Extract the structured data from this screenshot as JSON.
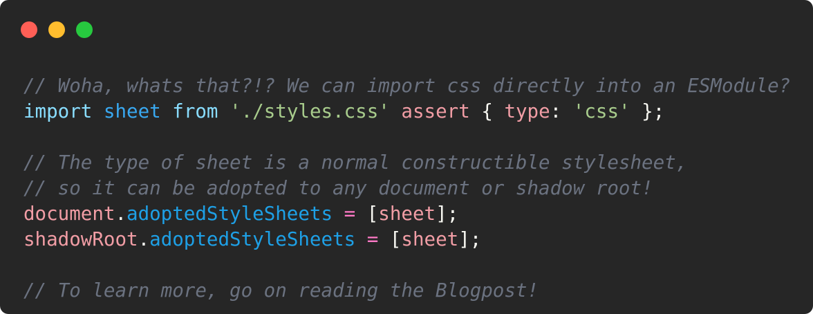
{
  "window": {
    "controls": [
      {
        "name": "close",
        "color": "#ff5f56"
      },
      {
        "name": "minimize",
        "color": "#ffbd2e"
      },
      {
        "name": "maximize",
        "color": "#27c93f"
      }
    ]
  },
  "code": {
    "lines": [
      [
        {
          "t": "// Woha, whats that?!? We can import css directly into an ESModule?",
          "k": "comment"
        }
      ],
      [
        {
          "t": "import",
          "k": "keyword"
        },
        {
          "t": " ",
          "k": "punct"
        },
        {
          "t": "sheet",
          "k": "ident"
        },
        {
          "t": " ",
          "k": "punct"
        },
        {
          "t": "from",
          "k": "keyword"
        },
        {
          "t": " ",
          "k": "punct"
        },
        {
          "t": "'./styles.css'",
          "k": "string"
        },
        {
          "t": " ",
          "k": "punct"
        },
        {
          "t": "assert",
          "k": "attr"
        },
        {
          "t": " { ",
          "k": "punct"
        },
        {
          "t": "type",
          "k": "attr"
        },
        {
          "t": ": ",
          "k": "punct"
        },
        {
          "t": "'css'",
          "k": "string"
        },
        {
          "t": " };",
          "k": "punct"
        }
      ],
      [],
      [
        {
          "t": "// The type of sheet is a normal constructible stylesheet,",
          "k": "comment"
        }
      ],
      [
        {
          "t": "// so it can be adopted to any document or shadow root!",
          "k": "comment"
        }
      ],
      [
        {
          "t": "document",
          "k": "var"
        },
        {
          "t": ".",
          "k": "punct"
        },
        {
          "t": "adoptedStyleSheets",
          "k": "prop"
        },
        {
          "t": " ",
          "k": "punct"
        },
        {
          "t": "=",
          "k": "op"
        },
        {
          "t": " [",
          "k": "punct"
        },
        {
          "t": "sheet",
          "k": "var"
        },
        {
          "t": "];",
          "k": "punct"
        }
      ],
      [
        {
          "t": "shadowRoot",
          "k": "var"
        },
        {
          "t": ".",
          "k": "punct"
        },
        {
          "t": "adoptedStyleSheets",
          "k": "prop"
        },
        {
          "t": " ",
          "k": "punct"
        },
        {
          "t": "=",
          "k": "op"
        },
        {
          "t": " [",
          "k": "punct"
        },
        {
          "t": "sheet",
          "k": "var"
        },
        {
          "t": "];",
          "k": "punct"
        }
      ],
      [],
      [
        {
          "t": "// To learn more, go on reading the Blogpost!",
          "k": "comment"
        }
      ]
    ]
  }
}
